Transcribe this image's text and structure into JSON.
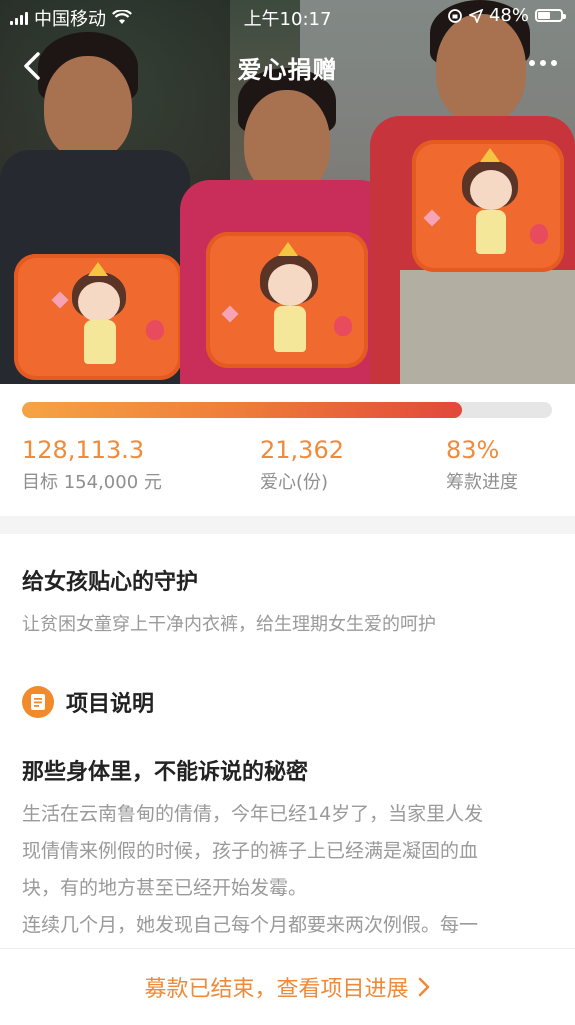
{
  "status_bar": {
    "carrier": "中国移动",
    "time": "上午10:17",
    "battery_percent": "48%",
    "battery_level": 0.48
  },
  "nav": {
    "title": "爱心捐赠",
    "back_icon": "chevron-left-icon",
    "more_icon": "more-dots-icon"
  },
  "progress": {
    "fraction": 0.83,
    "colors": {
      "start": "#f5a344",
      "end": "#e2483b",
      "track": "#e6e6e6"
    }
  },
  "stats": [
    {
      "value": "128,113.3",
      "label": "目标 154,000 元"
    },
    {
      "value": "21,362",
      "label": "爱心(份)"
    },
    {
      "value": "83%",
      "label": "筹款进度"
    }
  ],
  "project": {
    "title": "给女孩贴心的守护",
    "subtitle": "让贫困女童穿上干净内衣裤，给生理期女生爱的呵护"
  },
  "section": {
    "icon": "document-icon",
    "label": "项目说明"
  },
  "article": {
    "title": "那些身体里，不能诉说的秘密",
    "lines": [
      "生活在云南鲁甸的倩倩，今年已经14岁了，当家里人发",
      "现倩倩来例假的时候，孩子的裤子上已经满是凝固的血",
      "块，有的地方甚至已经开始发霉。",
      "连续几个月，她发现自己每个月都要来两次例假。每一"
    ]
  },
  "bottom_action": {
    "label": "募款已结束，查看项目进展",
    "icon": "chevron-right-icon",
    "color": "#ef8a3a"
  },
  "accent_color": "#f08b3a"
}
